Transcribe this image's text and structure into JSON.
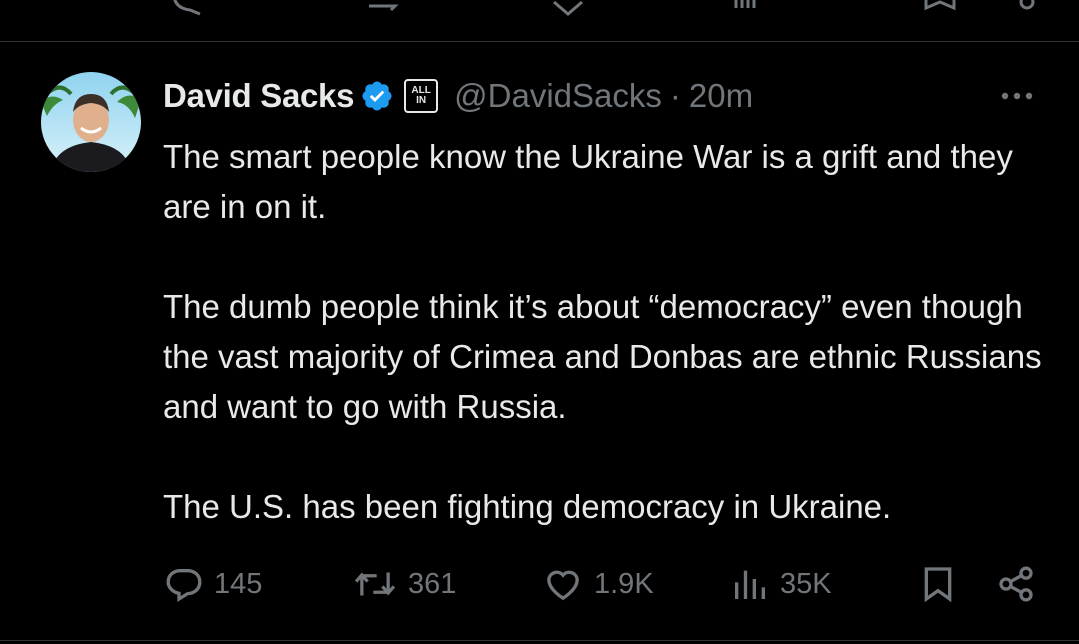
{
  "tweet": {
    "display_name": "David Sacks",
    "affiliation_badge": [
      "ALL",
      "IN"
    ],
    "handle": "@DavidSacks",
    "separator": "·",
    "time": "20m",
    "paragraphs": [
      "The smart people know the Ukraine War is a grift and they are in on it.",
      "The dumb people think it’s about “democracy” even though the vast majority of Crimea and Donbas are ethnic Russians and want to go with Russia.",
      "The U.S. has been fighting democracy in Ukraine."
    ],
    "actions": {
      "replies": "145",
      "reposts": "361",
      "likes": "1.9K",
      "views": "35K"
    }
  },
  "colors": {
    "background": "#000000",
    "text": "#e7e9ea",
    "muted": "#71767b",
    "verified": "#1d9bf0",
    "divider": "#2f3336"
  },
  "icons": [
    "verified-icon",
    "more-icon",
    "reply-icon",
    "repost-icon",
    "like-icon",
    "views-icon",
    "bookmark-icon",
    "share-icon"
  ]
}
